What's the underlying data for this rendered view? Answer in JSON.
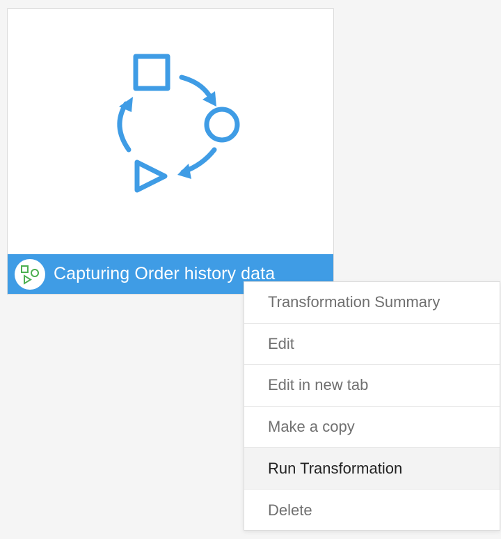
{
  "card": {
    "title": "Capturing Order history data",
    "art_icon": "transformation-cycle-icon",
    "badge_icon": "transformation-shapes-icon",
    "accent_color": "#3f9ce5",
    "badge_icon_color": "#4caf50"
  },
  "context_menu": {
    "items": [
      {
        "label": "Transformation Summary",
        "state": "normal"
      },
      {
        "label": "Edit",
        "state": "normal"
      },
      {
        "label": "Edit in new tab",
        "state": "normal"
      },
      {
        "label": "Make a copy",
        "state": "normal"
      },
      {
        "label": "Run Transformation",
        "state": "hovered"
      },
      {
        "label": "Delete",
        "state": "normal"
      }
    ]
  }
}
